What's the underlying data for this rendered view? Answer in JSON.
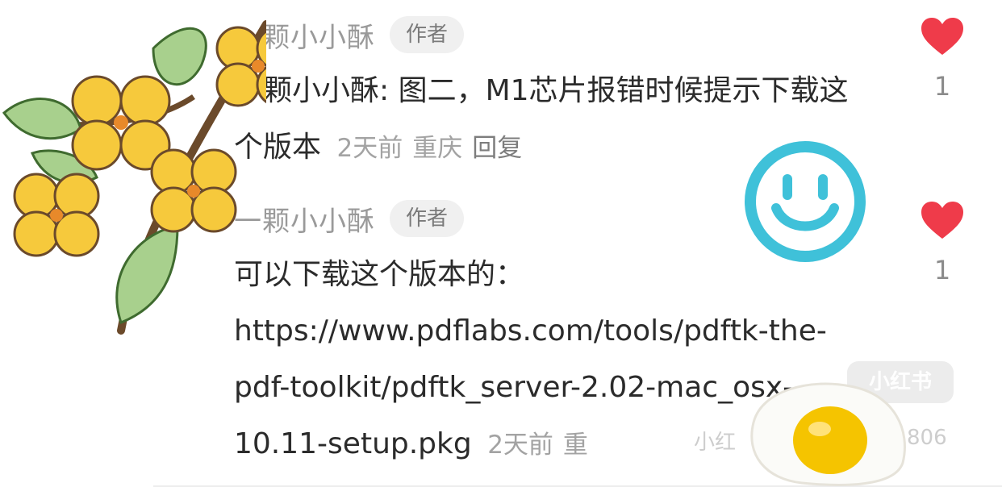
{
  "comments": [
    {
      "username": "一颗小小酥",
      "badge": "作者",
      "reply_to": "一颗小小酥",
      "reply_separator": ": ",
      "text": "图二，M1芯片报错时候提示下载这个版本",
      "time": "2天前",
      "location": "重庆",
      "reply_label": "回复",
      "like_count": "1"
    },
    {
      "username": "一颗小小酥",
      "badge": "作者",
      "text": "可以下载这个版本的：https://www.pdflabs.com/tools/pdftk-the-pdf-toolkit/pdftk_server-2.02-mac_osx-10.11-setup.pkg",
      "time": "2天前",
      "location": "重",
      "like_count": "1"
    }
  ],
  "watermark": {
    "logo_text": "小红书",
    "id_label": "小红",
    "id_suffix": "806"
  },
  "colors": {
    "heart": "#ef3b4a",
    "username": "#9a9a9a",
    "meta": "#a3a3a3",
    "content": "#2b2b2b",
    "badge_bg": "#f0f0f0",
    "smiley": "#3fc1d9",
    "flower": "#f4c430"
  },
  "icons": {
    "like": "heart-icon",
    "sticker_1": "osmanthus-flowers-sticker",
    "sticker_2": "smiley-face-sticker",
    "sticker_3": "fried-egg-sticker"
  }
}
